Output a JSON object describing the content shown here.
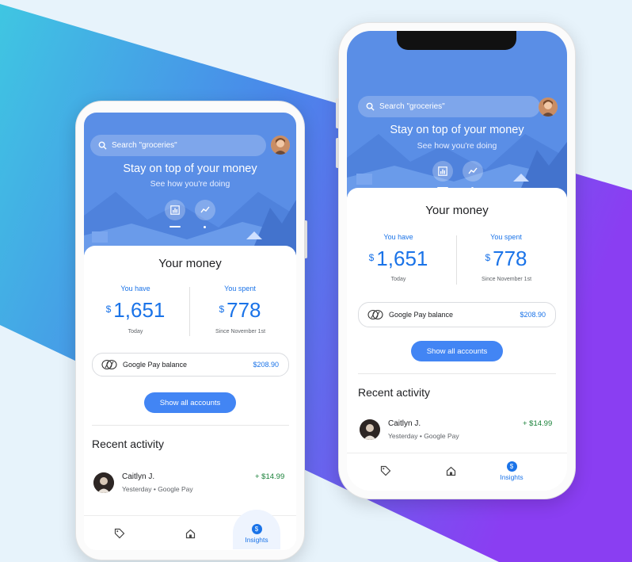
{
  "screens": [
    {
      "id": "android",
      "search_placeholder": "Search \"groceries\"",
      "hero_title": "Stay on top of your money",
      "hero_subtitle": "See how you're doing",
      "money_title": "Your money",
      "you_have_label": "You have",
      "you_have_currency": "$",
      "you_have_amount": "1,651",
      "you_have_sub": "Today",
      "you_spent_label": "You spent",
      "you_spent_currency": "$",
      "you_spent_amount": "778",
      "you_spent_sub": "Since November 1st",
      "gpay_label": "Google Pay balance",
      "gpay_amount": "$208.90",
      "show_accounts": "Show all accounts",
      "recent_title": "Recent activity",
      "activity_name": "Caitlyn J.",
      "activity_meta": "Yesterday • Google Pay",
      "activity_amount": "+ $14.99",
      "nav_insights": "Insights",
      "nav_insights_badge": "$"
    },
    {
      "id": "iphone",
      "search_placeholder": "Search \"groceries\"",
      "hero_title": "Stay on top of your money",
      "hero_subtitle": "See how you're doing",
      "money_title": "Your money",
      "you_have_label": "You have",
      "you_have_currency": "$",
      "you_have_amount": "1,651",
      "you_have_sub": "Today",
      "you_spent_label": "You spent",
      "you_spent_currency": "$",
      "you_spent_amount": "778",
      "you_spent_sub": "Since November 1st",
      "gpay_label": "Google Pay balance",
      "gpay_amount": "$208.90",
      "show_accounts": "Show all accounts",
      "recent_title": "Recent activity",
      "activity_name": "Caitlyn J.",
      "activity_meta": "Yesterday • Google Pay",
      "activity_amount": "+ $14.99",
      "nav_insights": "Insights",
      "nav_insights_badge": "$"
    }
  ],
  "colors": {
    "accent": "#1a73e8",
    "hero": "#5a8ee6",
    "positive": "#188038",
    "band_left": "#43c4e0",
    "band_right": "#7b3ff0"
  }
}
